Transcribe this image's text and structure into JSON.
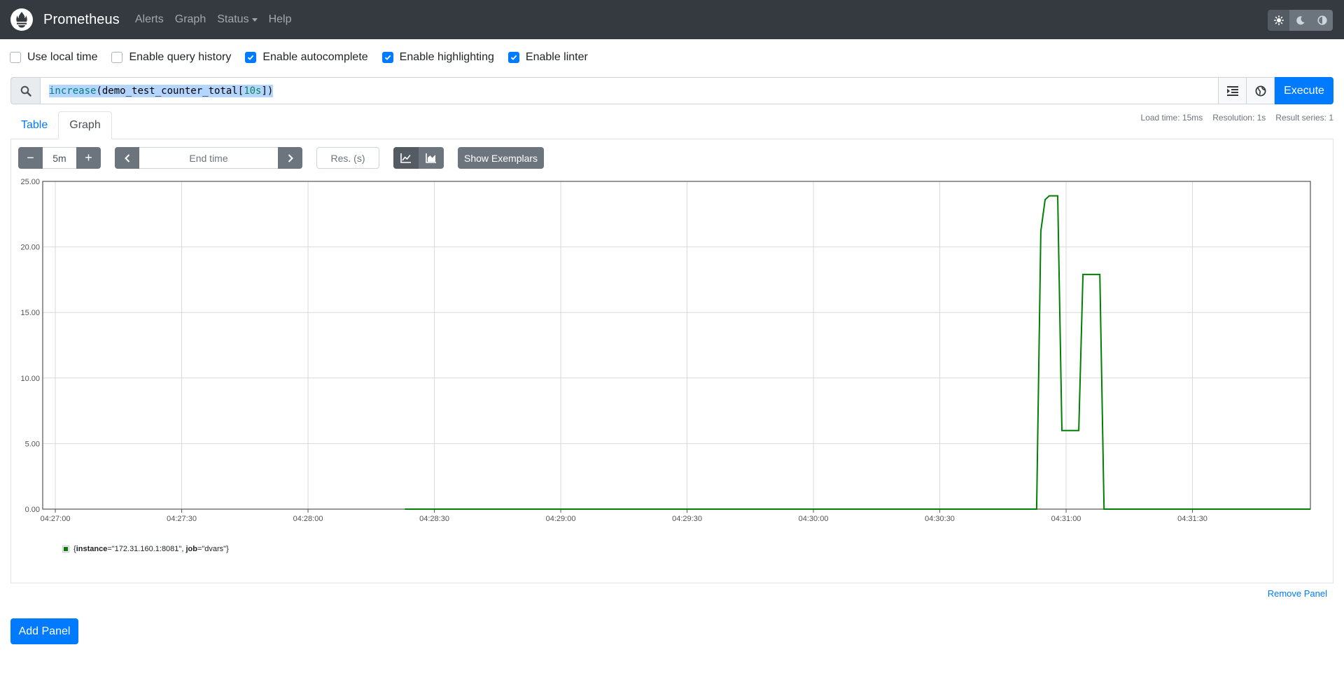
{
  "navbar": {
    "brand": "Prometheus",
    "links": [
      "Alerts",
      "Graph",
      "Status",
      "Help"
    ],
    "theme_icons": [
      "sun-icon",
      "moon-icon",
      "adjust-icon"
    ]
  },
  "options": [
    {
      "label": "Use local time",
      "checked": false
    },
    {
      "label": "Enable query history",
      "checked": false
    },
    {
      "label": "Enable autocomplete",
      "checked": true
    },
    {
      "label": "Enable highlighting",
      "checked": true
    },
    {
      "label": "Enable linter",
      "checked": true
    }
  ],
  "query": {
    "fn": "increase",
    "open": "(",
    "metric": "demo_test_counter_total",
    "range_open": "[",
    "range": "10s",
    "range_close": "]",
    "close": ")",
    "execute_label": "Execute"
  },
  "tabs": {
    "table": "Table",
    "graph": "Graph"
  },
  "stats": {
    "load_time": "Load time: 15ms",
    "resolution": "Resolution: 1s",
    "result_series": "Result series: 1"
  },
  "controls": {
    "minus": "−",
    "range": "5m",
    "plus": "+",
    "end_time_placeholder": "End time",
    "res_placeholder": "Res. (s)",
    "show_exemplars": "Show Exemplars"
  },
  "chart_data": {
    "type": "line",
    "series": [
      {
        "name": "{instance=\"172.31.160.1:8081\", job=\"dvars\"}",
        "color": "#008000",
        "points": [
          [
            "04:28:23",
            0
          ],
          [
            "04:30:53",
            0
          ],
          [
            "04:30:54",
            21.2
          ],
          [
            "04:30:55",
            23.6
          ],
          [
            "04:30:56",
            23.9
          ],
          [
            "04:30:58",
            23.9
          ],
          [
            "04:30:59",
            6.0
          ],
          [
            "04:31:03",
            6.0
          ],
          [
            "04:31:04",
            17.9
          ],
          [
            "04:31:08",
            17.9
          ],
          [
            "04:31:09",
            0
          ],
          [
            "04:31:58",
            0
          ]
        ]
      }
    ],
    "x_ticks": [
      "04:27:00",
      "04:27:30",
      "04:28:00",
      "04:28:30",
      "04:29:00",
      "04:29:30",
      "04:30:00",
      "04:30:30",
      "04:31:00",
      "04:31:30"
    ],
    "x_range": [
      "04:26:57",
      "04:31:58"
    ],
    "y_ticks": [
      "0.00",
      "5.00",
      "10.00",
      "15.00",
      "20.00",
      "25.00"
    ],
    "ylim": [
      0,
      25
    ],
    "grid": true
  },
  "legend": {
    "open": "{",
    "k1": "instance",
    "v1": "=\"172.31.160.1:8081\", ",
    "k2": "job",
    "v2": "=\"dvars\"",
    "close": "}"
  },
  "actions": {
    "remove_panel": "Remove Panel",
    "add_panel": "Add Panel"
  }
}
